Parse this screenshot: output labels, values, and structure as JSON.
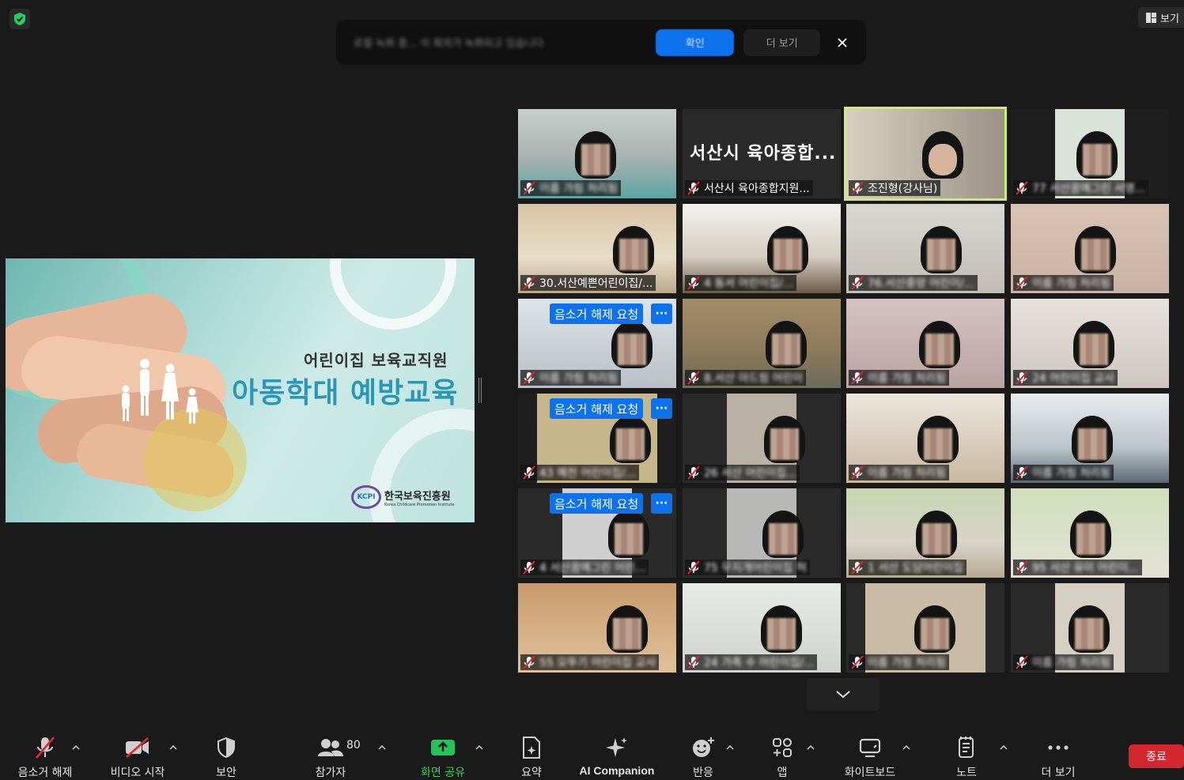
{
  "top": {
    "view_label": "보기",
    "notice": {
      "text": "로컬 녹화 중... 이 회의가 녹화되고 있습니다",
      "primary_label": "확인",
      "secondary_label": "더 보기"
    }
  },
  "share": {
    "subtitle": "어린이집 보육교직원",
    "title": "아동학대 예방교육",
    "logo_mark": "KCPI",
    "logo_korean": "한국보육진흥원",
    "logo_english": "Korea Childcare Promotion Institute"
  },
  "gallery": {
    "unmute_request_label": "음소거 해제 요청",
    "more_label": "···",
    "tiles": [
      {
        "name": "이름 가림 처리됨",
        "blur": true
      },
      {
        "name": "서산시 육아종합지원...",
        "blur": false,
        "big_name": "서산시 육아종합..."
      },
      {
        "name": "조진형(강사님)",
        "blur": false,
        "active": true
      },
      {
        "name": "77 서산꿈에그린 서영...",
        "blur": true
      },
      {
        "name": "30.서산예쁜어린이집/...",
        "blur": false
      },
      {
        "name": "4 동서 어린이집/...",
        "blur": true
      },
      {
        "name": "76.서산중앙 어린이/...",
        "blur": true
      },
      {
        "name": "이름 가림 처리됨",
        "blur": true
      },
      {
        "name": "이름 가림 처리됨",
        "blur": true,
        "unmute_request": true
      },
      {
        "name": "8.서산 아드림 어린이",
        "blur": true
      },
      {
        "name": "이름 가림 처리됨",
        "blur": true
      },
      {
        "name": "24 어린이집 교사",
        "blur": true
      },
      {
        "name": "43 예천 어린이집/...",
        "blur": true,
        "unmute_request": true
      },
      {
        "name": "26 서산 어린이집...",
        "blur": true
      },
      {
        "name": "이름 가림 처리됨",
        "blur": true
      },
      {
        "name": "이름 가림 처리됨",
        "blur": true
      },
      {
        "name": "4 서산꿈에그린 어린...",
        "blur": true,
        "unmute_request": true
      },
      {
        "name": "75 무지개어린이집 허",
        "blur": true
      },
      {
        "name": "1 서산 도담어린이집",
        "blur": true
      },
      {
        "name": "95 서산 유미 어린이...",
        "blur": true
      },
      {
        "name": "55 오뚜기 어린이집 교사",
        "blur": true
      },
      {
        "name": "24 가족 수 어린이집/...",
        "blur": true
      },
      {
        "name": "이름 가림 처리됨",
        "blur": true
      },
      {
        "name": "이름 가림 처리됨",
        "blur": true
      }
    ]
  },
  "toolbar": {
    "mute_label": "음소거 해제",
    "video_label": "비디오 시작",
    "security_label": "보안",
    "participants_label": "참가자",
    "participants_count": "80",
    "share_label": "화면 공유",
    "summary_label": "요약",
    "ai_label": "AI Companion",
    "reactions_label": "반응",
    "apps_label": "앱",
    "whiteboard_label": "화이트보드",
    "notes_label": "노트",
    "more_label": "더 보기",
    "end_label": "종료"
  },
  "colors": {
    "accent_blue": "#0e72ed",
    "share_green": "#34d058",
    "end_red": "#d3272f",
    "active_speaker": "#c8ee6a",
    "muted_red": "#e0262d"
  }
}
